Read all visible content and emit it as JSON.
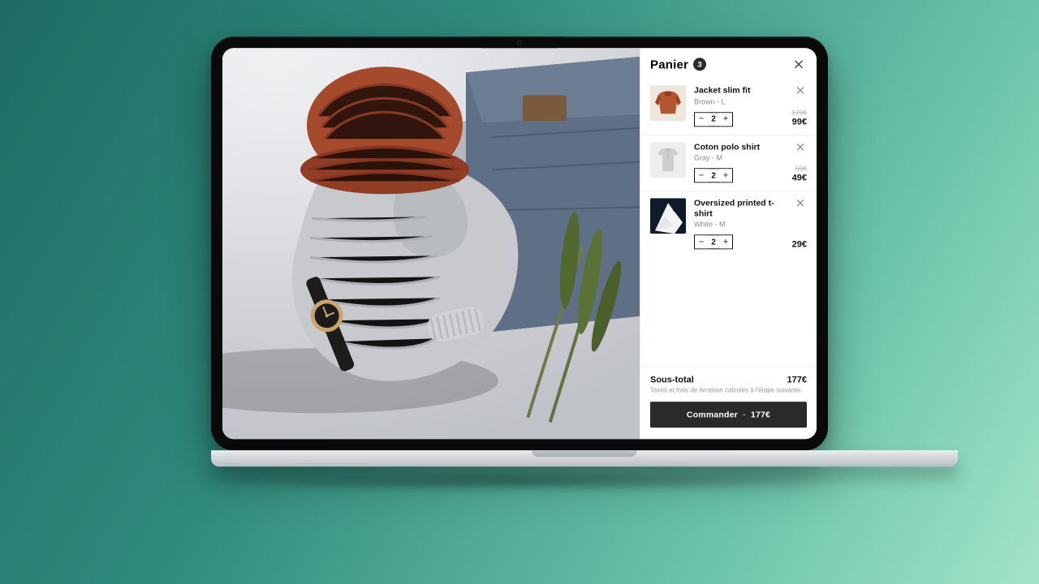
{
  "cart": {
    "title": "Panier",
    "count": "3",
    "close_aria": "Fermer",
    "items": [
      {
        "name": "Jacket slim fit",
        "variant": "Brown - L",
        "qty": "2",
        "compare_at": "129€",
        "price": "99€",
        "thumb": "jacket-brown"
      },
      {
        "name": "Coton polo shirt",
        "variant": "Gray - M",
        "qty": "2",
        "compare_at": "59€",
        "price": "49€",
        "thumb": "polo-gray"
      },
      {
        "name": "Oversized printed t-shirt",
        "variant": "White - M",
        "qty": "2",
        "compare_at": "",
        "price": "29€",
        "thumb": "tee-white"
      }
    ],
    "subtotal_label": "Sous-total",
    "subtotal": "177€",
    "tax_note": "Taxes et frais de livraison calculés à l'étape suivante.",
    "checkout_label": "Commander",
    "checkout_amount": "177€"
  },
  "hero": {
    "alt": "Flat-lay: rust knit beanie, gray turtleneck sweater, folded blue jeans, black-strap wristwatch, green leaves on white bedsheet"
  }
}
